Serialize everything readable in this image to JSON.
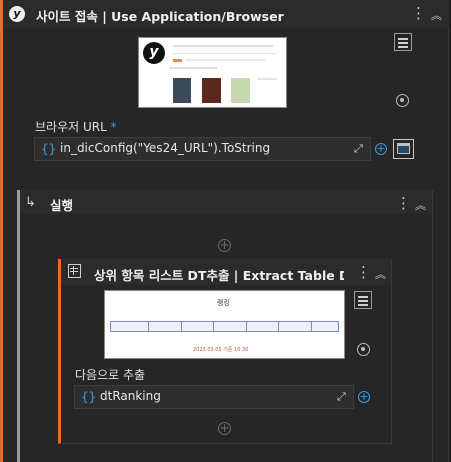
{
  "activity": {
    "title": "사이트 접속 | Use Application/Browser",
    "browser_url_label": "브라우저 URL",
    "required_mark": "*",
    "url_value": "in_dicConfig(\"Yes24_URL\").ToString",
    "icon": "yes24-logo",
    "logo_letter": "y"
  },
  "sequence": {
    "title": "실행"
  },
  "extract": {
    "title": "상위 항목 리스트 DT추출 | Extract Table D...",
    "extract_label": "다음으로 추출",
    "output_value": "dtRanking",
    "thumb_heading": "랭킹",
    "thumb_date": "2023.03.05 기준 10:30"
  },
  "colors": {
    "accent": "#e86b28",
    "variable_blue": "#3f9be0"
  }
}
